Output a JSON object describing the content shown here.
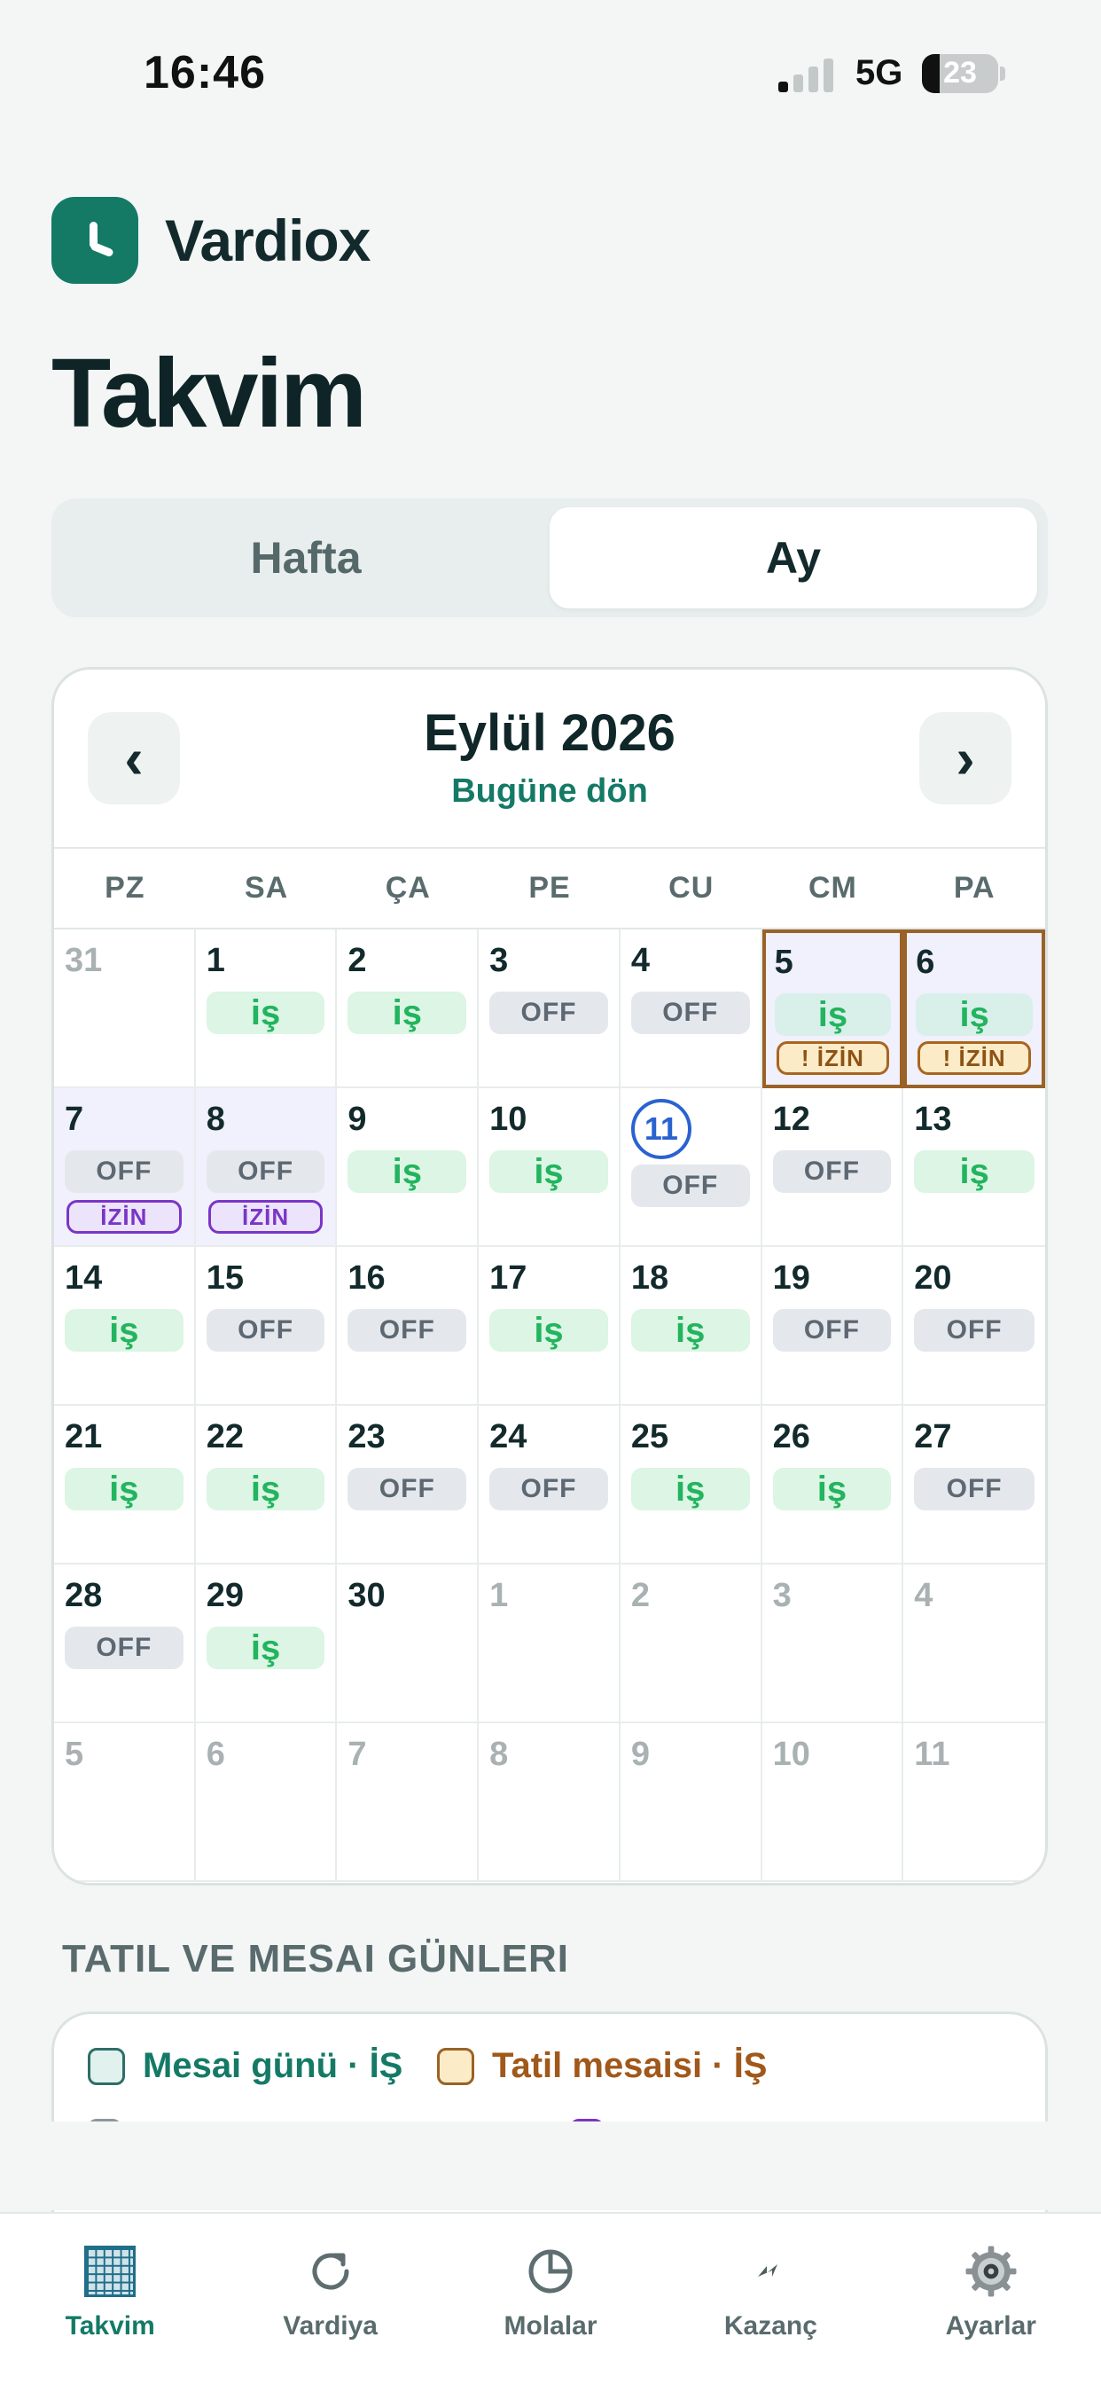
{
  "status_bar": {
    "time": "16:46",
    "network": "5G",
    "battery": "23",
    "battery_level": 0.23,
    "signal_bars": 1
  },
  "brand": {
    "name": "Vardiox"
  },
  "page_title": "Takvim",
  "segments": {
    "week": "Hafta",
    "month": "Ay",
    "selected": "Ay"
  },
  "calendar": {
    "month_title": "Eylül 2026",
    "today_link": "Bugüne dön",
    "prev_icon": "‹",
    "next_icon": "›",
    "weekdays": [
      "PZ",
      "SA",
      "ÇA",
      "PE",
      "CU",
      "CM",
      "PA"
    ],
    "days": [
      {
        "day": "31",
        "muted": true
      },
      {
        "day": "1",
        "status": "iş"
      },
      {
        "day": "2",
        "status": "iş"
      },
      {
        "day": "3",
        "status": "OFF"
      },
      {
        "day": "4",
        "status": "OFF"
      },
      {
        "day": "5",
        "status": "iş",
        "tag": "! İZİN",
        "tag_style": "warn",
        "highlight": true
      },
      {
        "day": "6",
        "status": "iş",
        "tag": "! İZİN",
        "tag_style": "warn",
        "highlight": true
      },
      {
        "day": "7",
        "status": "OFF",
        "tag": "İZİN",
        "tag_style": "izin",
        "shade": true
      },
      {
        "day": "8",
        "status": "OFF",
        "tag": "İZİN",
        "tag_style": "izin",
        "shade": true
      },
      {
        "day": "9",
        "status": "iş"
      },
      {
        "day": "10",
        "status": "iş"
      },
      {
        "day": "11",
        "status": "OFF",
        "today": true
      },
      {
        "day": "12",
        "status": "OFF"
      },
      {
        "day": "13",
        "status": "iş"
      },
      {
        "day": "14",
        "status": "iş"
      },
      {
        "day": "15",
        "status": "OFF"
      },
      {
        "day": "16",
        "status": "OFF"
      },
      {
        "day": "17",
        "status": "iş"
      },
      {
        "day": "18",
        "status": "iş"
      },
      {
        "day": "19",
        "status": "OFF"
      },
      {
        "day": "20",
        "status": "OFF"
      },
      {
        "day": "21",
        "status": "iş"
      },
      {
        "day": "22",
        "status": "iş"
      },
      {
        "day": "23",
        "status": "OFF"
      },
      {
        "day": "24",
        "status": "OFF"
      },
      {
        "day": "25",
        "status": "iş"
      },
      {
        "day": "26",
        "status": "iş"
      },
      {
        "day": "27",
        "status": "OFF"
      },
      {
        "day": "28",
        "status": "OFF"
      },
      {
        "day": "29",
        "status": "iş"
      },
      {
        "day": "30"
      },
      {
        "day": "1",
        "muted": true
      },
      {
        "day": "2",
        "muted": true
      },
      {
        "day": "3",
        "muted": true
      },
      {
        "day": "4",
        "muted": true
      },
      {
        "day": "5",
        "muted": true
      },
      {
        "day": "6",
        "muted": true
      },
      {
        "day": "7",
        "muted": true
      },
      {
        "day": "8",
        "muted": true
      },
      {
        "day": "9",
        "muted": true
      },
      {
        "day": "10",
        "muted": true
      },
      {
        "day": "11",
        "muted": true
      }
    ]
  },
  "legend": {
    "title": "TATIL VE MESAI GÜNLERI",
    "items": [
      {
        "label": "Mesai günü · İŞ",
        "color": "#147a66"
      },
      {
        "label": "Tatil mesaisi · İŞ",
        "color": "#a0581b"
      }
    ]
  },
  "tabs": [
    {
      "label": "Takvim",
      "icon": "calendar-grid-icon",
      "active": true
    },
    {
      "label": "Vardiya",
      "icon": "refresh-icon"
    },
    {
      "label": "Molalar",
      "icon": "pie-clock-icon"
    },
    {
      "label": "Kazanç",
      "icon": "lightning-icon"
    },
    {
      "label": "Ayarlar",
      "icon": "gear-icon"
    }
  ],
  "colors": {
    "accent": "#147a66",
    "work": "#22b45e",
    "today": "#2a63d0",
    "leave": "#7b35c6",
    "holiday": "#9a6226"
  }
}
